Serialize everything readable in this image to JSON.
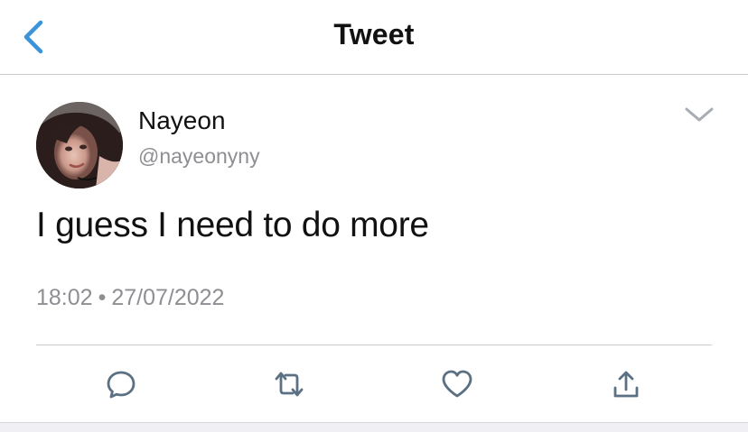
{
  "navbar": {
    "title": "Tweet",
    "back_icon": "chevron-left-icon"
  },
  "tweet": {
    "author_name": "Nayeon",
    "author_handle": "@nayeonyny",
    "text": "I guess I need to do more",
    "time": "18:02",
    "separator": "•",
    "date": "27/07/2022",
    "more_icon": "chevron-down-icon"
  },
  "actions": {
    "reply_icon": "reply-bubble-icon",
    "retweet_icon": "retweet-icon",
    "like_icon": "heart-icon",
    "share_icon": "share-icon"
  },
  "colors": {
    "accent": "#3b94d9",
    "text": "#111111",
    "muted": "#8e8e93",
    "action_icon": "#5b7083",
    "divider": "#c9c9c9"
  }
}
